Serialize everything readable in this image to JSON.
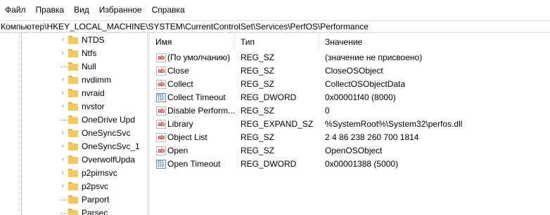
{
  "menu": [
    "Файл",
    "Правка",
    "Вид",
    "Избранное",
    "Справка"
  ],
  "address": "Компьютер\\HKEY_LOCAL_MACHINE\\SYSTEM\\CurrentControlSet\\Services\\PerfOS\\Performance",
  "tree": {
    "items": [
      {
        "label": "NTDS",
        "expandable": true
      },
      {
        "label": "Ntfs",
        "expandable": true
      },
      {
        "label": "Null",
        "expandable": false
      },
      {
        "label": "nvdimm",
        "expandable": true
      },
      {
        "label": "nvraid",
        "expandable": true
      },
      {
        "label": "nvstor",
        "expandable": true
      },
      {
        "label": "OneDrive Upd",
        "expandable": false
      },
      {
        "label": "OneSyncSvc",
        "expandable": true
      },
      {
        "label": "OneSyncSvc_1",
        "expandable": true
      },
      {
        "label": "OverwolfUpda",
        "expandable": true
      },
      {
        "label": "p2pimsvc",
        "expandable": true
      },
      {
        "label": "p2psvc",
        "expandable": true
      },
      {
        "label": "Parport",
        "expandable": false
      },
      {
        "label": "Parsec",
        "expandable": false
      }
    ]
  },
  "list": {
    "columns": [
      "Имя",
      "Тип",
      "Значение"
    ],
    "rows": [
      {
        "icon": "string-value-icon",
        "name": "(По умолчанию)",
        "type": "REG_SZ",
        "value": "(значение не присвоено)"
      },
      {
        "icon": "string-value-icon",
        "name": "Close",
        "type": "REG_SZ",
        "value": "CloseOSObject"
      },
      {
        "icon": "string-value-icon",
        "name": "Collect",
        "type": "REG_SZ",
        "value": "CollectOSObjectData"
      },
      {
        "icon": "binary-value-icon",
        "name": "Collect Timeout",
        "type": "REG_DWORD",
        "value": "0x00001f40 (8000)"
      },
      {
        "icon": "string-value-icon",
        "name": "Disable Perform...",
        "type": "REG_SZ",
        "value": "0"
      },
      {
        "icon": "string-value-icon",
        "name": "Library",
        "type": "REG_EXPAND_SZ",
        "value": "%SystemRoot%\\System32\\perfos.dll"
      },
      {
        "icon": "string-value-icon",
        "name": "Object List",
        "type": "REG_SZ",
        "value": "2 4 86 238 260 700 1814"
      },
      {
        "icon": "string-value-icon",
        "name": "Open",
        "type": "REG_SZ",
        "value": "OpenOSObject"
      },
      {
        "icon": "binary-value-icon",
        "name": "Open Timeout",
        "type": "REG_DWORD",
        "value": "0x00001388 (5000)"
      }
    ]
  }
}
